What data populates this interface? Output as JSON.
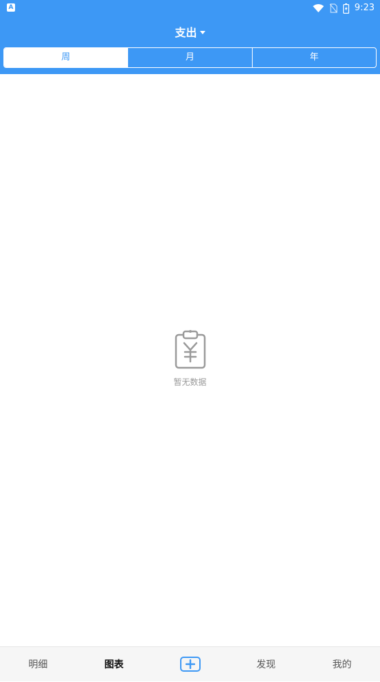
{
  "status_bar": {
    "left_icon_glyph": "A",
    "time": "9:23",
    "icons": [
      "wifi-icon",
      "no-sim-icon",
      "battery-charging-icon"
    ]
  },
  "header": {
    "title": "支出",
    "title_icon": "caret-down-icon",
    "period_tabs": [
      {
        "label": "周",
        "active": true
      },
      {
        "label": "月",
        "active": false
      },
      {
        "label": "年",
        "active": false
      }
    ]
  },
  "main": {
    "empty_icon": "clipboard-yen-icon",
    "empty_text": "暂无数据"
  },
  "tabbar": {
    "items": [
      {
        "label": "明细",
        "active": false
      },
      {
        "label": "图表",
        "active": true
      },
      {
        "label": "",
        "icon": "add-icon"
      },
      {
        "label": "发现",
        "active": false
      },
      {
        "label": "我的",
        "active": false
      }
    ]
  },
  "colors": {
    "primary": "#3d98f5",
    "tabbar_bg": "#f6f6f6",
    "empty_text": "#999999"
  }
}
